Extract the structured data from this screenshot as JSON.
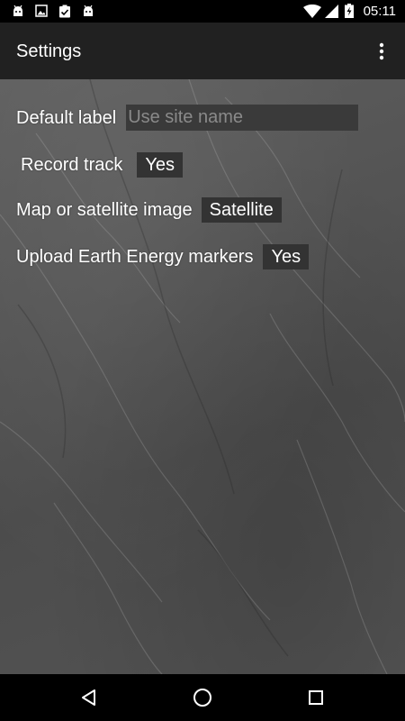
{
  "status_bar": {
    "time": "05:11",
    "notification_icons": [
      "android-icon",
      "image-icon",
      "clipboard-check-icon",
      "android-icon"
    ],
    "system_icons": [
      "wifi-icon",
      "signal-icon",
      "battery-charging-icon"
    ]
  },
  "action_bar": {
    "title": "Settings",
    "overflow_icon": "more-vert-icon"
  },
  "settings": {
    "default_label": {
      "label": "Default label",
      "value": "",
      "placeholder": "Use site name"
    },
    "record_track": {
      "label": "Record track",
      "value": "Yes"
    },
    "map_or_satellite": {
      "label": "Map or satellite image",
      "value": "Satellite"
    },
    "upload_markers": {
      "label": "Upload Earth Energy markers",
      "value": "Yes"
    }
  },
  "nav_bar": {
    "back_icon": "back-triangle-icon",
    "home_icon": "home-circle-icon",
    "recents_icon": "recents-square-icon"
  },
  "colors": {
    "status_bar": "#000000",
    "action_bar": "#212121",
    "value_box": "#333333",
    "text": "#ffffff",
    "placeholder": "#8a8a8a"
  }
}
